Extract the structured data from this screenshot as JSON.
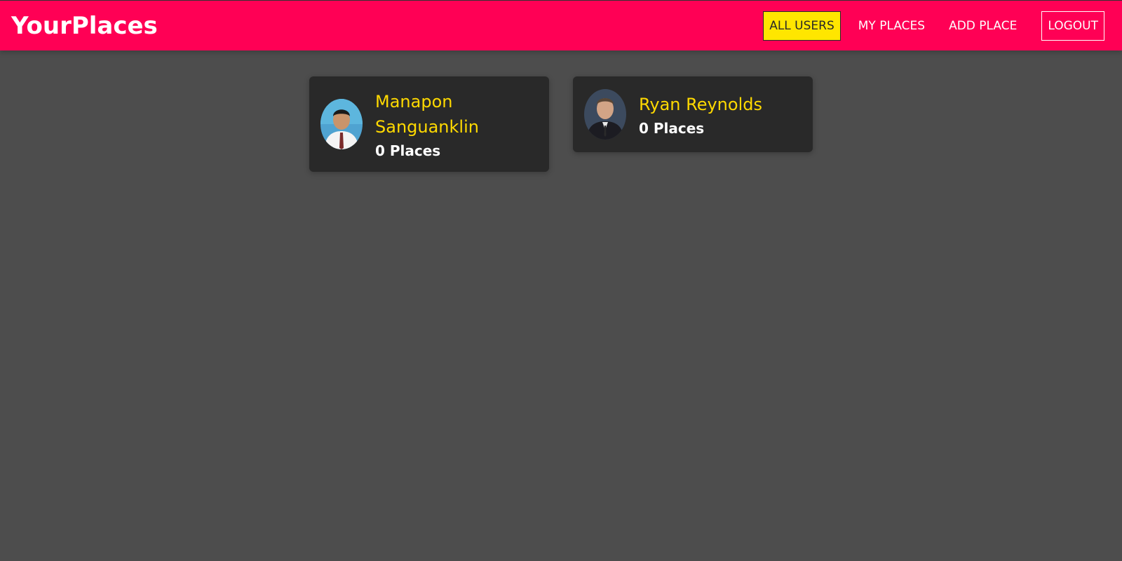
{
  "app": {
    "brand": "YourPlaces"
  },
  "nav": {
    "all_users": "ALL USERS",
    "my_places": "MY PLACES",
    "add_place": "ADD PLACE",
    "logout": "LOGOUT"
  },
  "users": [
    {
      "name": "Manapon Sanguanklin",
      "places": "0 Places"
    },
    {
      "name": "Ryan Reynolds",
      "places": "0 Places"
    }
  ],
  "colors": {
    "header": "#ff0055",
    "active_nav": "#ffe600",
    "name": "#ffd900",
    "card": "#292929",
    "background": "#4d4d4d"
  }
}
